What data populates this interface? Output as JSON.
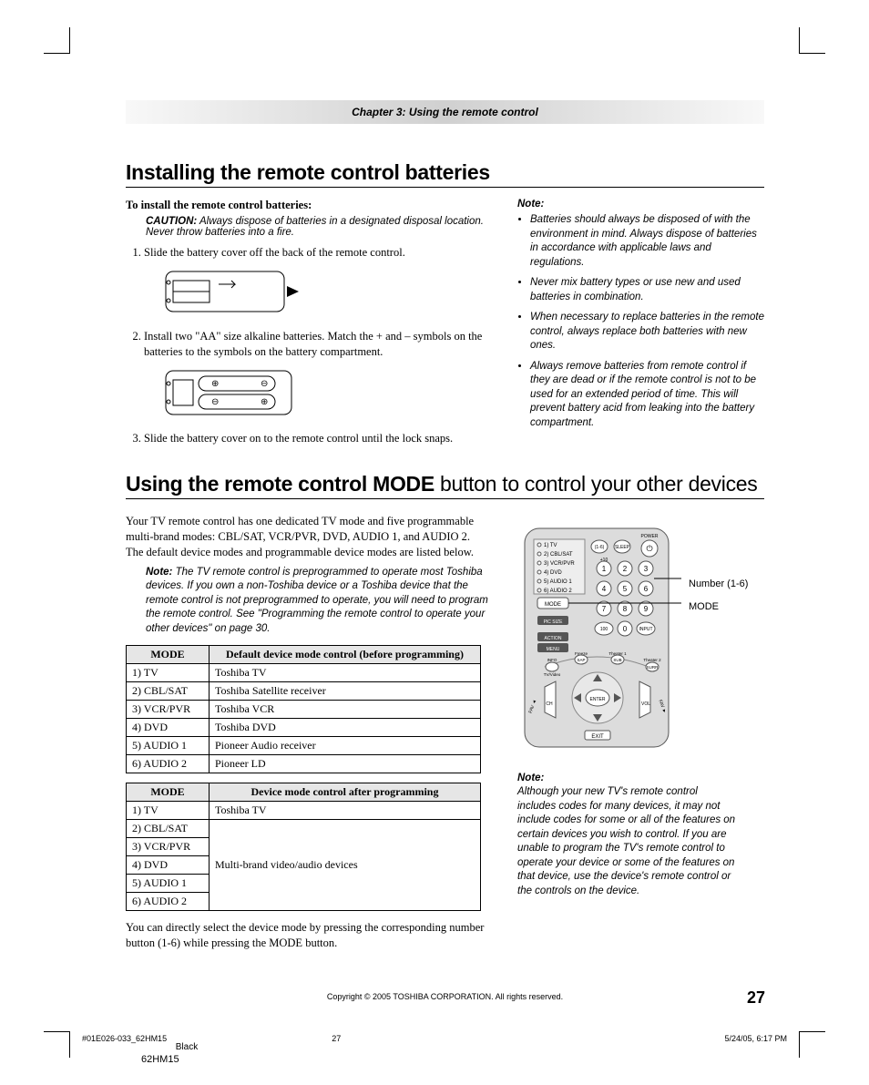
{
  "chapter_bar": "Chapter 3: Using the remote control",
  "section1_title": "Installing the remote control batteries",
  "install_heading": "To install the remote control batteries:",
  "caution_label": "CAUTION:",
  "caution_text": "Always dispose of batteries in a designated disposal location. Never throw batteries into a fire.",
  "step1": "Slide the battery cover off the back of the remote control.",
  "step2": "Install two \"AA\" size alkaline batteries. Match the + and – symbols on the batteries to the symbols on the battery compartment.",
  "step3": "Slide the battery cover on to the remote control until the lock snaps.",
  "note_title": "Note:",
  "note_items": [
    "Batteries should always be disposed of with the environment in mind. Always dispose of batteries in accordance with applicable laws and regulations.",
    "Never mix battery types or use new and used batteries in combination.",
    "When necessary to replace batteries in the remote control, always replace both batteries with new ones.",
    "Always remove batteries from remote control if they are dead or if the remote control is not to be used for an extended period of time. This will prevent battery acid from leaking into the battery compartment."
  ],
  "section2_title_a": "Using the remote control ",
  "section2_title_b": "MODE",
  "section2_title_c": " button to control your other devices",
  "intro_p": "Your TV remote control has one dedicated TV mode and five programmable multi-brand modes: CBL/SAT, VCR/PVR, DVD, AUDIO 1, and AUDIO 2. The default device modes and programmable device modes are listed below.",
  "innote_label": "Note:",
  "innote_text": "The TV remote control is preprogrammed to operate most Toshiba devices. If you own a non-Toshiba device or a Toshiba device that the remote control is not preprogrammed to operate, you will need to program the remote control. See \"Programming the remote control to operate your other devices\" on page 30.",
  "table1_headers": [
    "MODE",
    "Default device mode control (before programming)"
  ],
  "table1_rows": [
    [
      "1) TV",
      "Toshiba TV"
    ],
    [
      "2) CBL/SAT",
      "Toshiba Satellite receiver"
    ],
    [
      "3) VCR/PVR",
      "Toshiba VCR"
    ],
    [
      "4) DVD",
      "Toshiba  DVD"
    ],
    [
      "5) AUDIO 1",
      "Pioneer Audio receiver"
    ],
    [
      "6) AUDIO 2",
      "Pioneer LD"
    ]
  ],
  "table2_headers": [
    "MODE",
    "Device mode control after programming"
  ],
  "table2_rows_mode": [
    "1) TV",
    "2) CBL/SAT",
    "3) VCR/PVR",
    "4) DVD",
    "5) AUDIO 1",
    "6) AUDIO 2"
  ],
  "table2_row1_val": "Toshiba TV",
  "table2_merged_val": "Multi-brand video/audio devices",
  "closing_p": "You can directly select the device mode by pressing the corresponding number button (1-6) while pressing the MODE button.",
  "callout_number": "Number (1-6)",
  "callout_mode": "MODE",
  "note2_title": "Note:",
  "note2_text": "Although your new TV's remote control includes codes for many devices, it may not include codes for some or all of the features on certain devices you wish to control. If you are unable to program the TV's remote control to operate your device or some of the features on that device, use the device's remote control or the controls on the device.",
  "copyright": "Copyright © 2005 TOSHIBA CORPORATION. All rights reserved.",
  "page_number": "27",
  "print_file": "#01E026-033_62HM15",
  "print_page": "27",
  "print_date": "5/24/05, 6:17 PM",
  "print_color": "Black",
  "print_model": "62HM15",
  "remote_labels": [
    "1) TV",
    "2) CBL/SAT",
    "3) VCR/PVR",
    "4) DVD",
    "5) AUDIO 1",
    "6) AUDIO 2"
  ],
  "remote_buttons_top": [
    "(1-6)",
    "SLEEP",
    "POWER"
  ],
  "remote_mode": "MODE",
  "remote_misc": [
    "PIC SIZE",
    "ACTION",
    "MENU",
    "INFO",
    "ENTER",
    "EXIT",
    "CH",
    "VOL",
    "100",
    "0",
    "INPUT",
    "+10",
    "SAP",
    "SUB",
    "SURR",
    "Freeze",
    "TV/Video",
    "Theater 1",
    "Theater 2"
  ]
}
